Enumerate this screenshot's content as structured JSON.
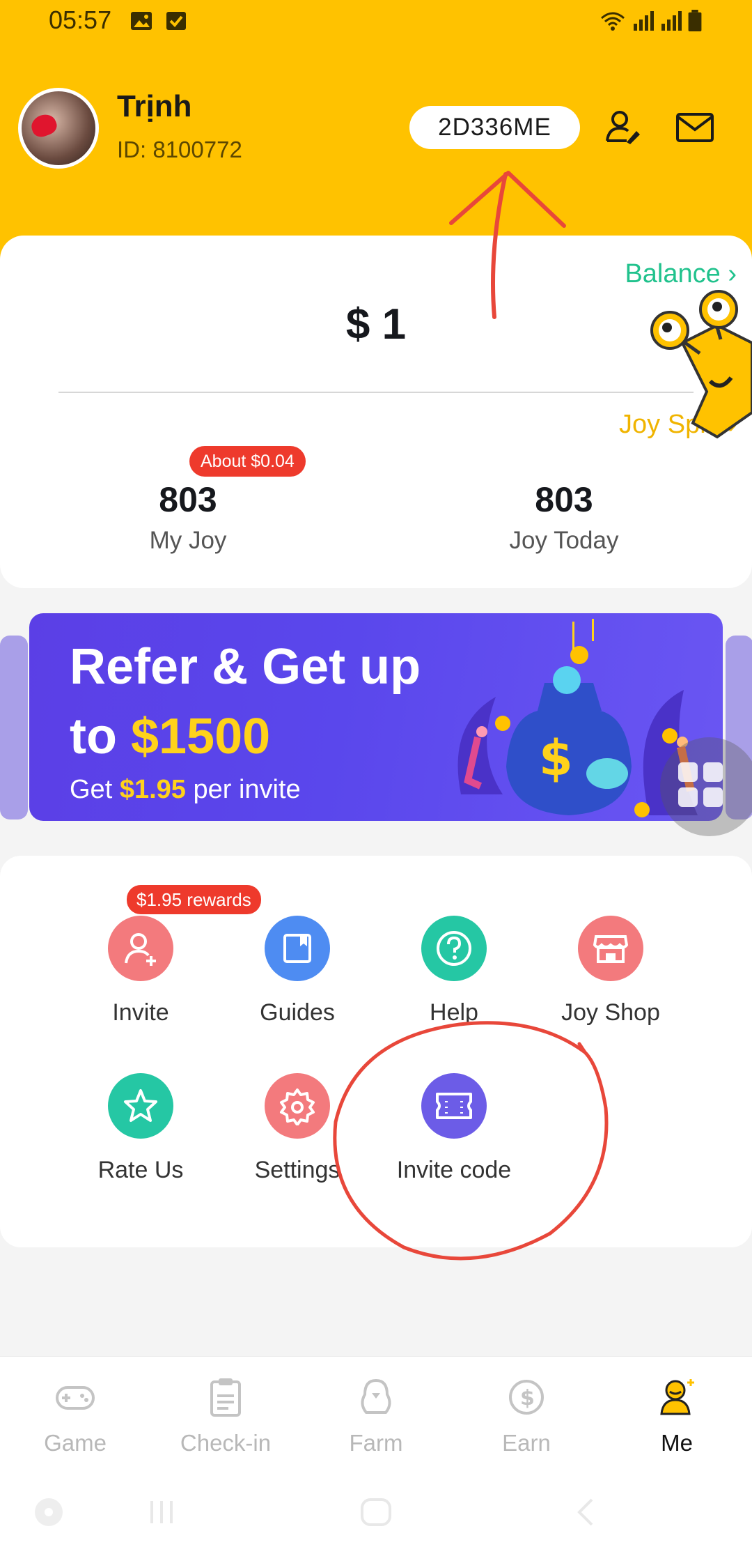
{
  "status_bar": {
    "time": "05:57"
  },
  "profile": {
    "name": "Trịnh",
    "id_text": "ID: 8100772",
    "invite_code": "2D336ME"
  },
  "balance_card": {
    "balance_link": "Balance",
    "amount": "$ 1",
    "joy_spin_link": "Joy Spin",
    "about_badge": "About $0.04",
    "my_joy_value": "803",
    "my_joy_label": "My Joy",
    "joy_today_value": "803",
    "joy_today_label": "Joy Today"
  },
  "banner": {
    "title_line1": "Refer & Get up",
    "title_line2_prefix": "to ",
    "title_line2_amount": "$1500",
    "sub_prefix": "Get ",
    "sub_amount": "$1.95",
    "sub_suffix": " per invite"
  },
  "menu": {
    "rewards_badge": "$1.95 rewards",
    "items": [
      {
        "label": "Invite",
        "icon": "person-add-icon",
        "color": "#f37a7d"
      },
      {
        "label": "Guides",
        "icon": "book-icon",
        "color": "#4e8cf2"
      },
      {
        "label": "Help",
        "icon": "question-icon",
        "color": "#25c7a4"
      },
      {
        "label": "Joy Shop",
        "icon": "shop-icon",
        "color": "#f37a7d"
      },
      {
        "label": "Rate Us",
        "icon": "star-icon",
        "color": "#25c7a4"
      },
      {
        "label": "Settings",
        "icon": "gear-icon",
        "color": "#f37a7d"
      },
      {
        "label": "Invite code",
        "icon": "ticket-icon",
        "color": "#6c5ce7"
      }
    ]
  },
  "bottom_nav": {
    "items": [
      {
        "label": "Game",
        "icon": "gamepad-icon"
      },
      {
        "label": "Check-in",
        "icon": "clipboard-icon"
      },
      {
        "label": "Farm",
        "icon": "chick-icon"
      },
      {
        "label": "Earn",
        "icon": "dollar-coin-icon"
      },
      {
        "label": "Me",
        "icon": "user-icon"
      }
    ],
    "active": "Me"
  },
  "colors": {
    "header_yellow": "#ffc200",
    "balance_green": "#21c28d",
    "joy_spin_yellow": "#f0b400",
    "badge_red": "#ee3a2c",
    "banner_purple": "#5a47ec",
    "annotation_red": "#e8473a"
  }
}
